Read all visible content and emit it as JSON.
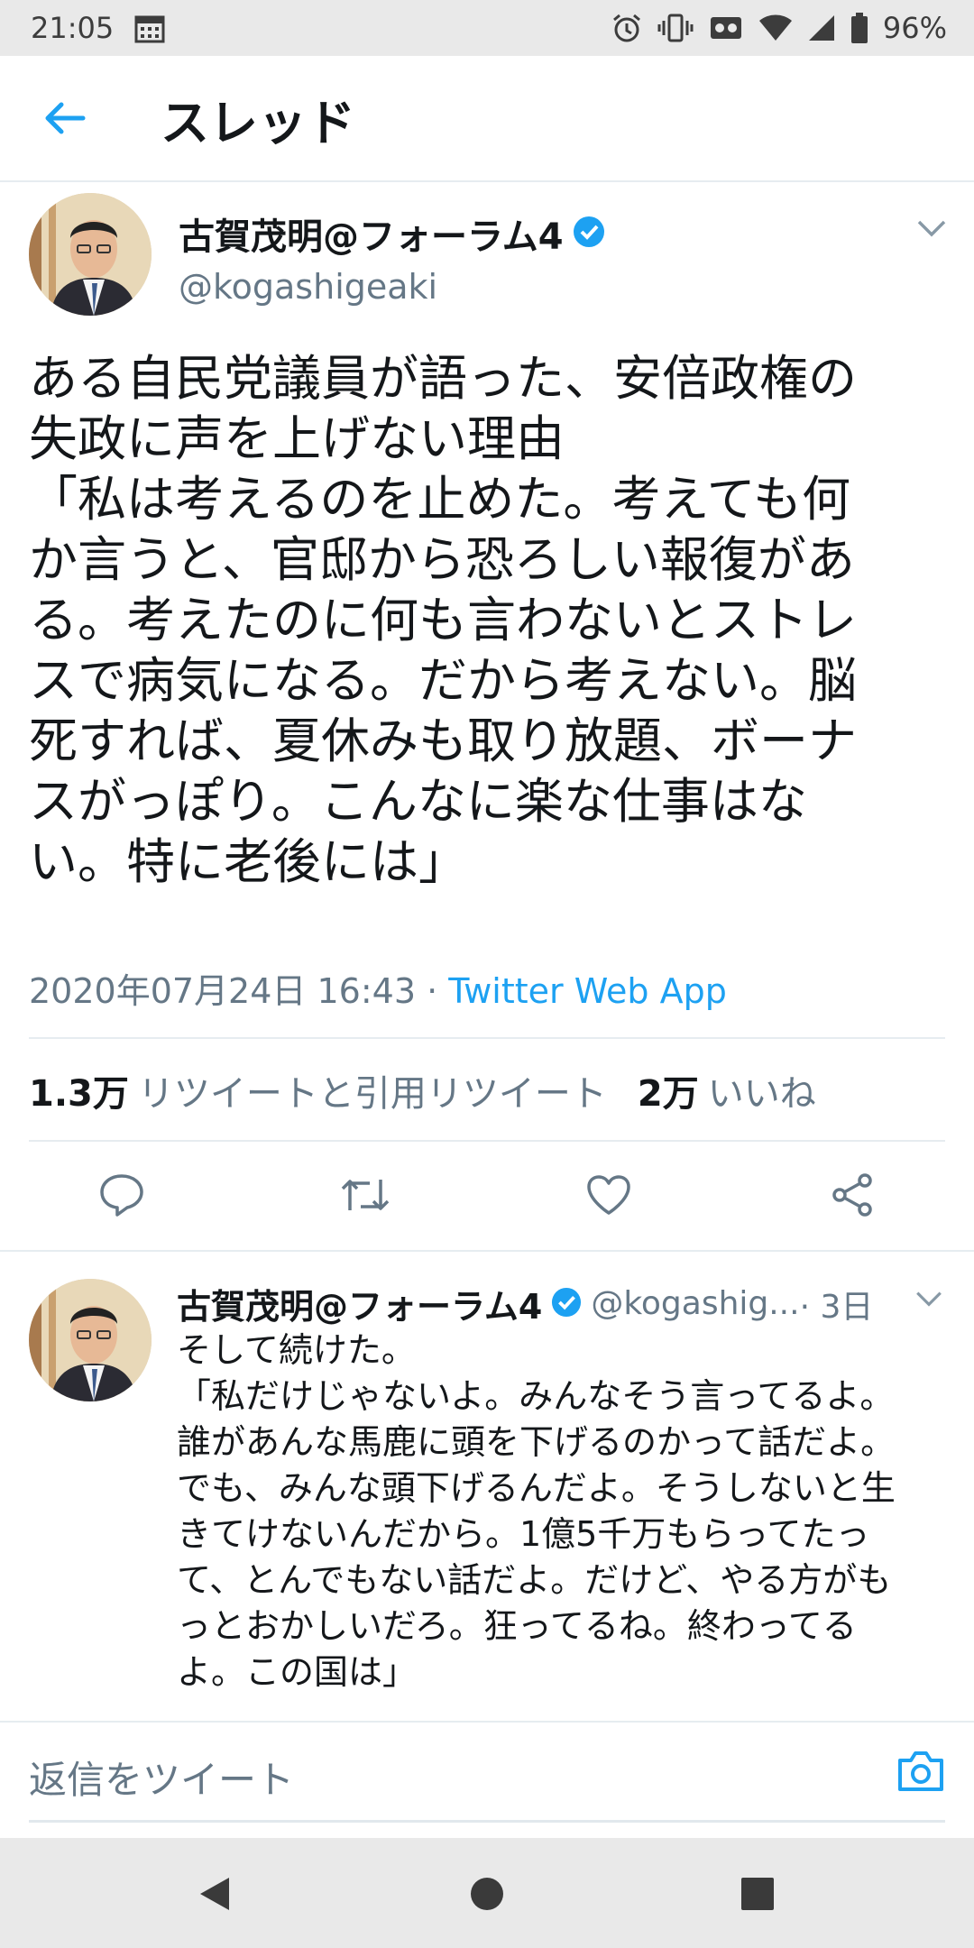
{
  "status_bar": {
    "time": "21:05",
    "battery": "96%",
    "icons": [
      "calendar-icon",
      "alarm-icon",
      "vibrate-icon",
      "cast-icon",
      "wifi-icon",
      "signal-icon",
      "battery-icon"
    ]
  },
  "app_bar": {
    "back_icon": "back-arrow-icon",
    "title": "スレッド"
  },
  "main_tweet": {
    "display_name": "古賀茂明@フォーラム4",
    "handle": "@kogashigeaki",
    "verified": true,
    "text": "ある自民党議員が語った、安倍政権の\n失政に声を上げない理由\n「私は考えるのを止めた。考えても何\nか言うと、官邸から恐ろしい報復があ\nる。考えたのに何も言わないとストレ\nスで病気になる。だから考えない。脳\n死すれば、夏休みも取り放題、ボーナ\nスがっぽり。こんなに楽な仕事はな\nい。特に老後には」",
    "timestamp": "2020年07月24日 16:43",
    "separator": " · ",
    "via": "Twitter Web App",
    "retweets_count": "1.3万",
    "retweets_label": "リツイートと引用リツイート",
    "likes_count": "2万",
    "likes_label": "いいね",
    "actions": [
      "reply-icon",
      "retweet-icon",
      "like-icon",
      "share-icon"
    ]
  },
  "reply_tweet": {
    "display_name": "古賀茂明@フォーラム4",
    "handle": "@kogashig...",
    "time_ago": " · 3日",
    "verified": true,
    "text": "そして続けた。\n「私だけじゃないよ。みんなそう言ってるよ。\n誰があんな馬鹿に頭を下げるのかって話だよ。\nでも、みんな頭下げるんだよ。そうしないと生\nきてけないんだから。1億5千万もらってたっ\nて、とんでもない話だよ。だけど、やる方がも\nっとおかしいだろ。狂ってるね。終わってる\nよ。この国は」"
  },
  "compose": {
    "placeholder": "返信をツイート",
    "camera_icon": "camera-icon"
  },
  "nav_bar": {
    "buttons": [
      "nav-back-icon",
      "nav-home-icon",
      "nav-recents-icon"
    ]
  },
  "colors": {
    "accent": "#1da1f2",
    "text": "#14171a",
    "secondary_text": "#657786",
    "divider": "#e6ecf0",
    "system_bar": "#e9e9e9"
  }
}
